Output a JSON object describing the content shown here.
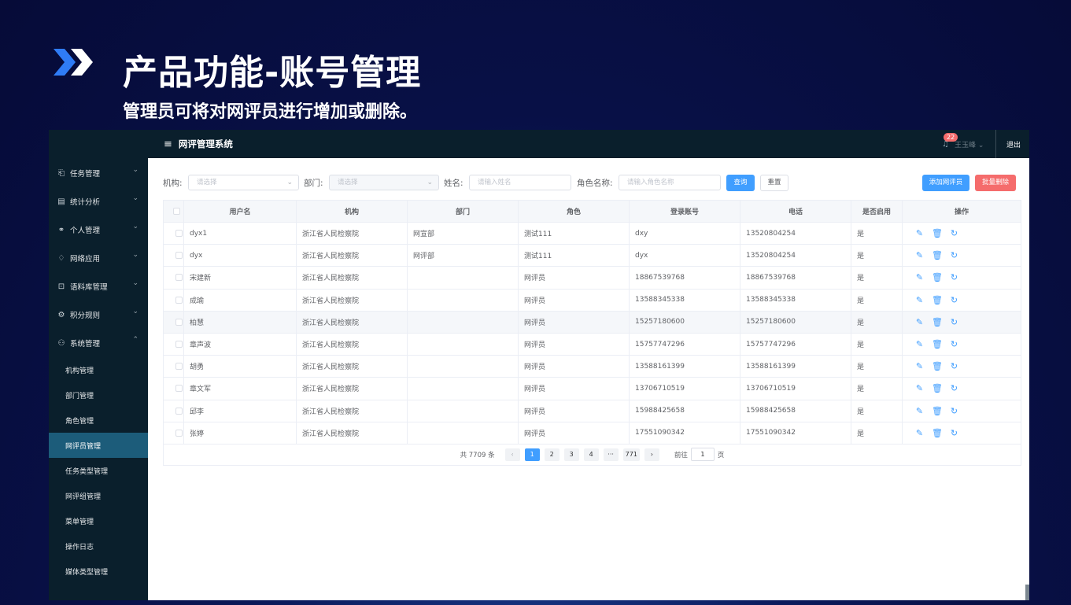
{
  "slide": {
    "title": "产品功能-账号管理",
    "subtitle": "管理员可将对网评员进行增加或删除。"
  },
  "sidebar": {
    "items": [
      {
        "label": "任务管理",
        "icon": "clipboard-icon",
        "glyph": "⎗",
        "chev": "⌄"
      },
      {
        "label": "统计分析",
        "icon": "document-icon",
        "glyph": "▤",
        "chev": "⌄"
      },
      {
        "label": "个人管理",
        "icon": "link-icon",
        "glyph": "⚭",
        "chev": "⌄"
      },
      {
        "label": "网络应用",
        "icon": "bell-icon",
        "glyph": "♢",
        "chev": "⌄"
      },
      {
        "label": "语料库管理",
        "icon": "lock-icon",
        "glyph": "⊡",
        "chev": "⌄"
      },
      {
        "label": "积分规则",
        "icon": "gear-icon",
        "glyph": "⚙",
        "chev": "⌄"
      },
      {
        "label": "系统管理",
        "icon": "user-icon",
        "glyph": "⚇",
        "chev": "⌃"
      }
    ],
    "subitems": [
      "机构管理",
      "部门管理",
      "角色管理",
      "网评员管理",
      "任务类型管理",
      "网评组管理",
      "菜单管理",
      "操作日志",
      "媒体类型管理"
    ]
  },
  "topbar": {
    "menu_glyph": "≡",
    "title": "网评管理系统",
    "badge": "22",
    "bell_glyph": "♫",
    "user": "王玉峰 ⌄",
    "logout": "退出"
  },
  "filters": {
    "org_label": "机构:",
    "org_placeholder": "请选择",
    "dept_label": "部门:",
    "dept_placeholder": "请选择",
    "name_label": "姓名:",
    "name_placeholder": "请输入姓名",
    "role_label": "角色名称:",
    "role_placeholder": "请输入角色名称",
    "arrow": "⌄",
    "query": "查询",
    "reset": "重置",
    "add": "添加网评员",
    "batch_delete": "批量删除"
  },
  "table": {
    "headers": [
      "用户名",
      "机构",
      "部门",
      "角色",
      "登录账号",
      "电话",
      "是否启用",
      "操作"
    ],
    "op_glyphs": [
      "✎",
      "🗑",
      "↻"
    ],
    "rows": [
      [
        "dyx1",
        "浙江省人民检察院",
        "网宣部",
        "测试111",
        "dxy",
        "13520804254",
        "是"
      ],
      [
        "dyx",
        "浙江省人民检察院",
        "网评部",
        "测试111",
        "dyx",
        "13520804254",
        "是"
      ],
      [
        "宋建新",
        "浙江省人民检察院",
        "",
        "网评员",
        "18867539768",
        "18867539768",
        "是"
      ],
      [
        "成瑜",
        "浙江省人民检察院",
        "",
        "网评员",
        "13588345338",
        "13588345338",
        "是"
      ],
      [
        "柏慧",
        "浙江省人民检察院",
        "",
        "网评员",
        "15257180600",
        "15257180600",
        "是"
      ],
      [
        "章声波",
        "浙江省人民检察院",
        "",
        "网评员",
        "15757747296",
        "15757747296",
        "是"
      ],
      [
        "胡勇",
        "浙江省人民检察院",
        "",
        "网评员",
        "13588161399",
        "13588161399",
        "是"
      ],
      [
        "章文军",
        "浙江省人民检察院",
        "",
        "网评员",
        "13706710519",
        "13706710519",
        "是"
      ],
      [
        "邱李",
        "浙江省人民检察院",
        "",
        "网评员",
        "15988425658",
        "15988425658",
        "是"
      ],
      [
        "张婷",
        "浙江省人民检察院",
        "",
        "网评员",
        "17551090342",
        "17551090342",
        "是"
      ]
    ]
  },
  "pagination": {
    "total": "共 7709 条",
    "prev": "‹",
    "pages": [
      "1",
      "2",
      "3",
      "4",
      "···",
      "771"
    ],
    "next": "›",
    "goto_label": "前往",
    "goto_value": "1",
    "goto_suffix": "页"
  },
  "colors": {
    "primary": "#409eff",
    "danger": "#f56c6c",
    "sidebar_bg": "#0a1f2c",
    "active_item": "#1c5c7a"
  }
}
